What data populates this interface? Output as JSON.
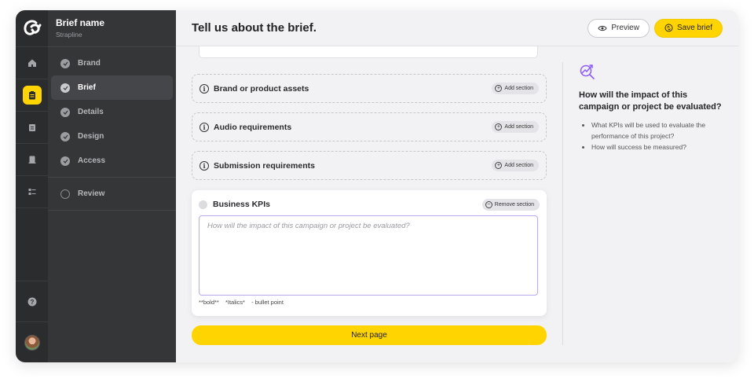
{
  "nav": {
    "brief_name": "Brief name",
    "strapline": "Strapline",
    "items": [
      {
        "label": "Brand",
        "state": "done"
      },
      {
        "label": "Brief",
        "state": "active"
      },
      {
        "label": "Details",
        "state": "done"
      },
      {
        "label": "Design",
        "state": "done"
      },
      {
        "label": "Access",
        "state": "done"
      },
      {
        "label": "Review",
        "state": "open"
      }
    ]
  },
  "rail": {
    "icons": [
      "home-icon",
      "brief-icon",
      "details-icon",
      "design-icon",
      "access-icon"
    ],
    "bottom_icons": [
      "help-icon",
      "user-avatar"
    ]
  },
  "header": {
    "title": "Tell us about the brief.",
    "preview_label": "Preview",
    "save_label": "Save brief"
  },
  "sections": [
    {
      "title": "Brand or product assets",
      "action": "Add section"
    },
    {
      "title": "Audio requirements",
      "action": "Add section"
    },
    {
      "title": "Submission requirements",
      "action": "Add section"
    }
  ],
  "active_section": {
    "title": "Business KPIs",
    "action": "Remove section",
    "placeholder": "How will the impact of this campaign or project be evaluated?",
    "hints": [
      "**bold**",
      "*Italics*",
      "- bullet point"
    ]
  },
  "next_label": "Next page",
  "aside": {
    "title": "How will the impact of this campaign or project be evaluated?",
    "bullets": [
      "What KPIs will be used to evaluate the performance of this project?",
      "How will success be measured?"
    ]
  },
  "colors": {
    "accent": "#ffd400",
    "rail": "#2b2c2e",
    "nav": "#353638",
    "focus": "#b9a8ea",
    "aside_icon": "#8b5cf6"
  }
}
